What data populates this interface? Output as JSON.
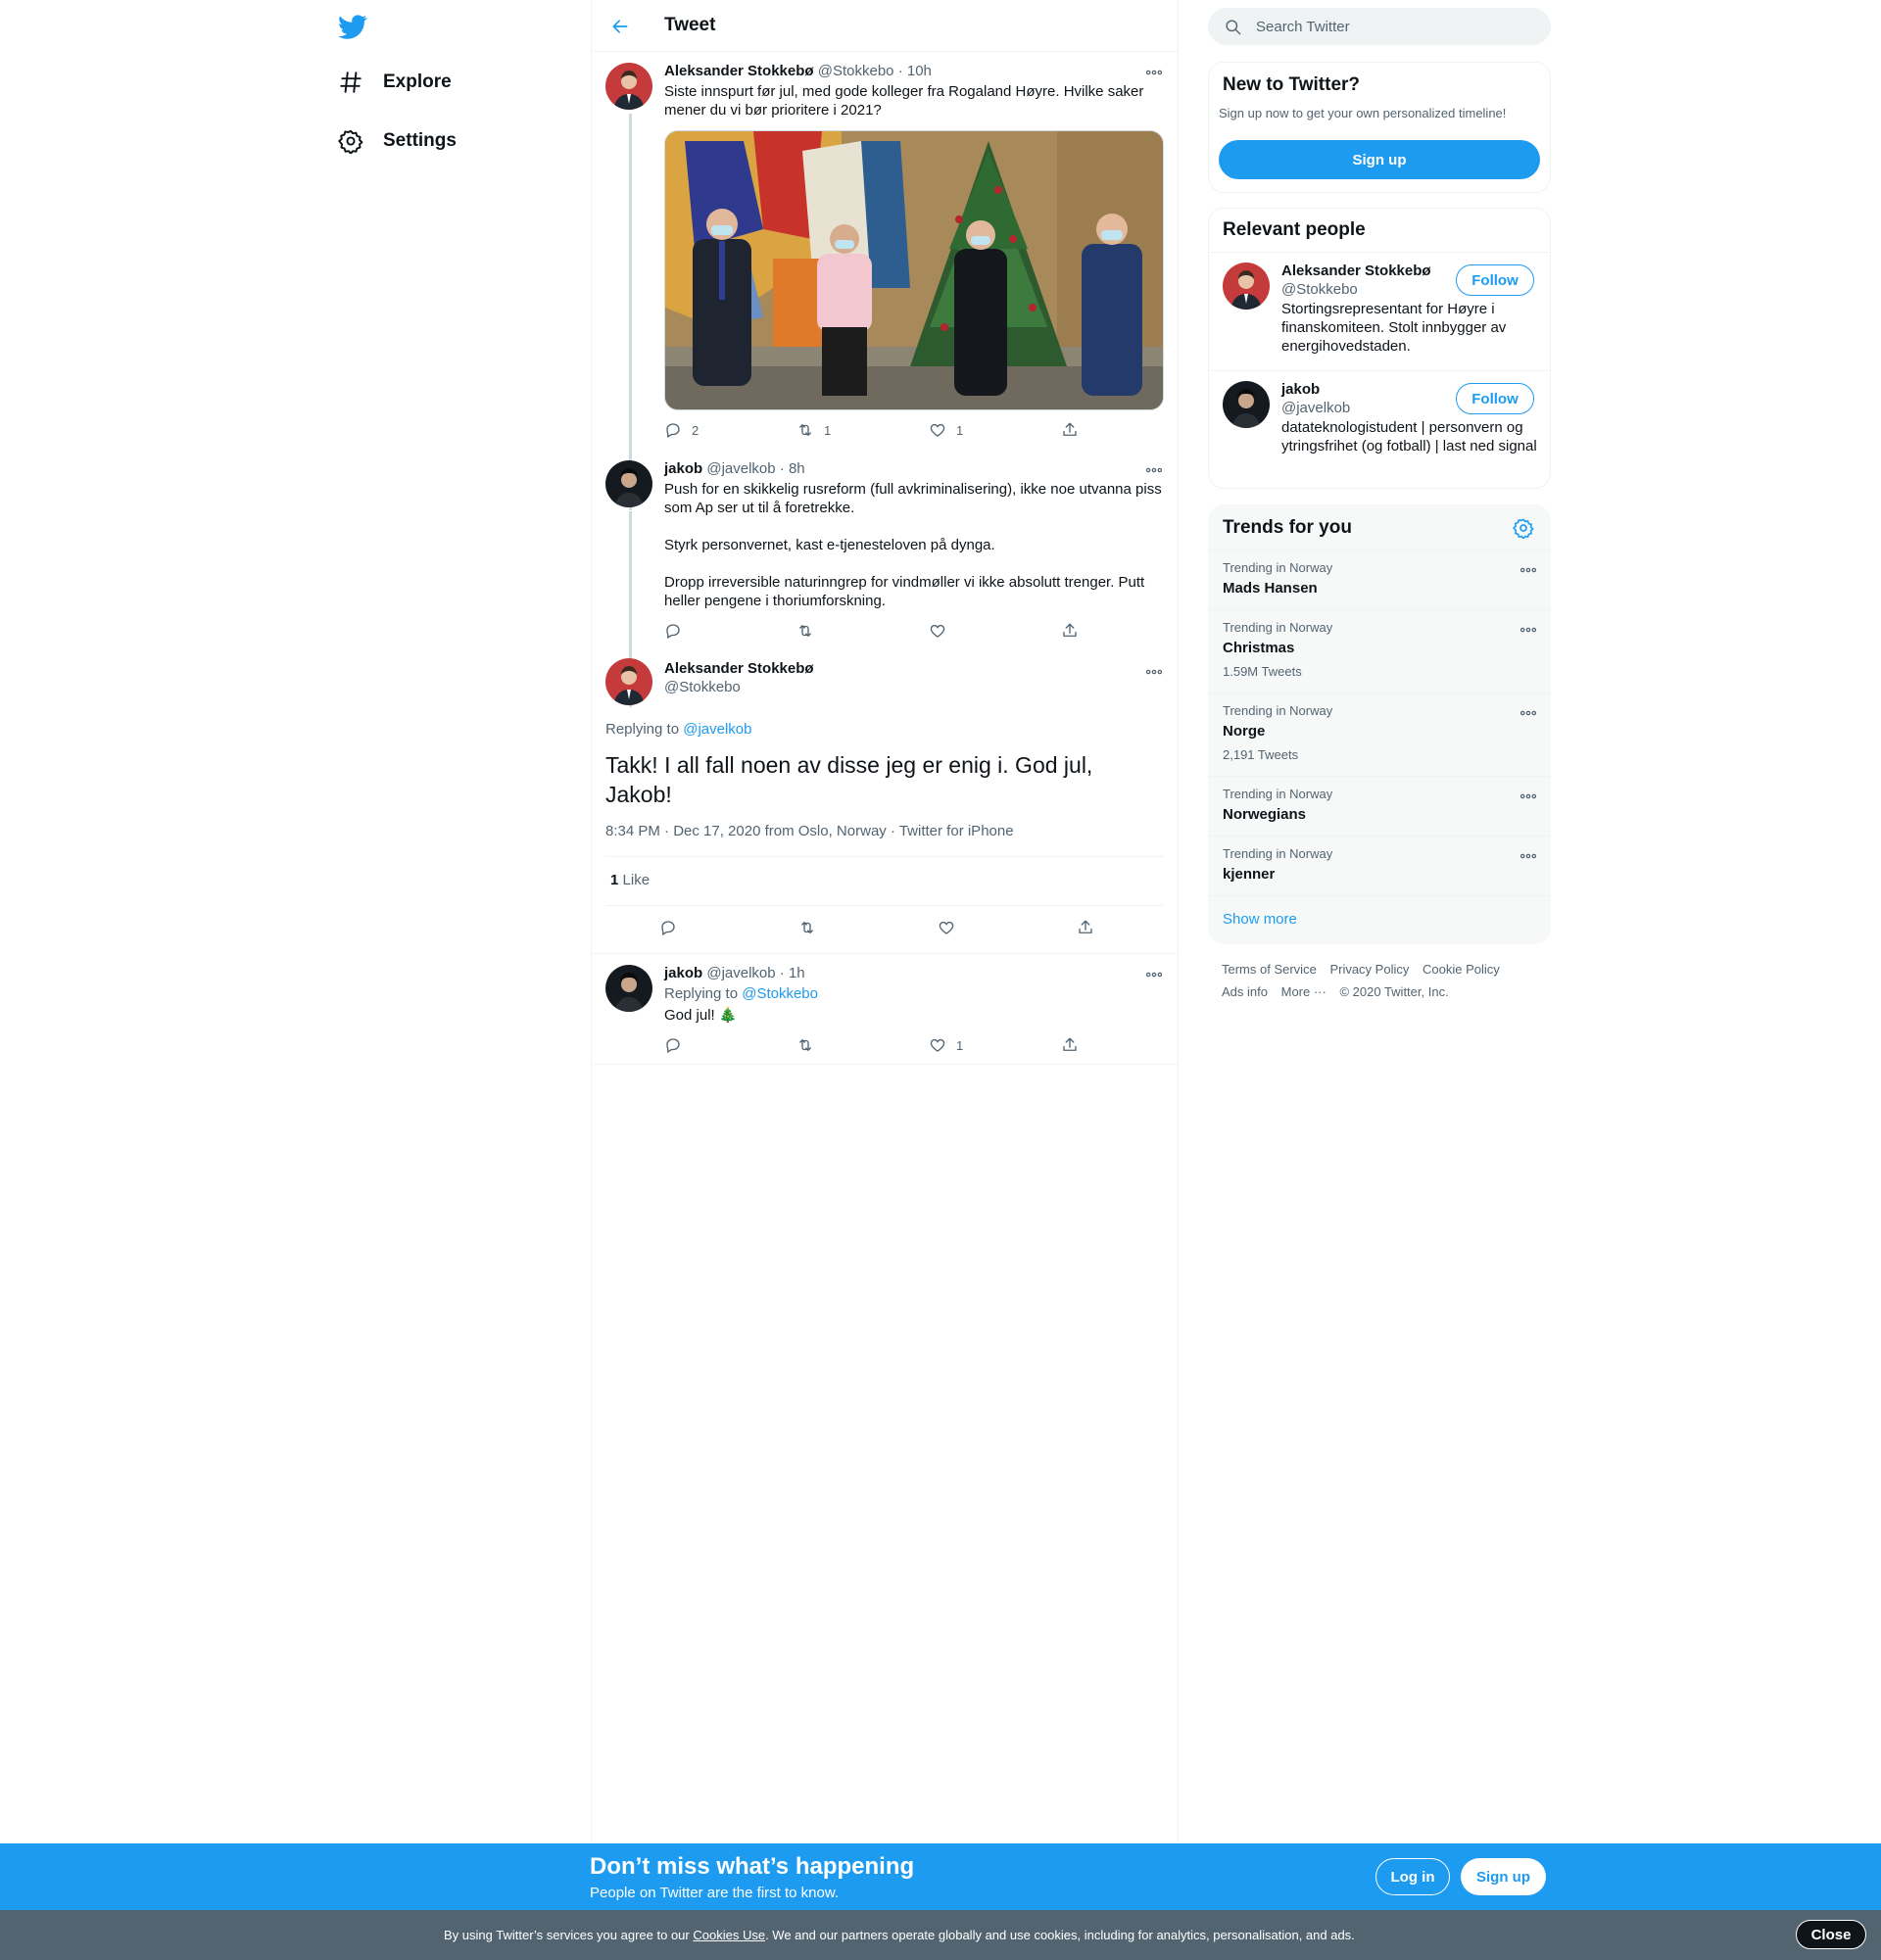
{
  "nav": {
    "logo_icon": "twitter-bird-icon",
    "items": [
      {
        "label": "Explore",
        "icon": "hashtag-icon"
      },
      {
        "label": "Settings",
        "icon": "gear-icon"
      }
    ]
  },
  "header": {
    "title": "Tweet",
    "back_icon": "arrow-left-icon"
  },
  "thread": [
    {
      "name": "Aleksander Stokkebø",
      "handle": "@Stokkebo",
      "time": "10h",
      "text": "Siste innspurt før jul, med gode kolleger fra Rogaland Høyre. Hvilke saker mener du vi bør prioritere i 2021?",
      "has_photo": true,
      "replies": "2",
      "retweets": "1",
      "likes": "1"
    },
    {
      "name": "jakob",
      "handle": "@javelkob",
      "time": "8h",
      "text_paragraphs": [
        "Push for en skikkelig rusreform (full avkriminalisering), ikke noe utvanna piss som Ap ser ut til å foretrekke.",
        "Styrk personvernet, kast e-tjenesteloven på dynga.",
        "Dropp irreversible naturinngrep for vindmøller vi ikke absolutt trenger. Putt heller pengene i thoriumforskning."
      ]
    }
  ],
  "main_tweet": {
    "name": "Aleksander Stokkebø",
    "handle": "@Stokkebo",
    "replying_to_prefix": "Replying to",
    "replying_to": "@javelkob",
    "text": "Takk! I all fall noen av disse jeg er enig i. God jul, Jakob!",
    "timestamp": "8:34 PM · Dec 17, 2020 from Oslo, Norway · Twitter for iPhone",
    "like_count": "1",
    "like_label": "Like"
  },
  "reply": {
    "name": "jakob",
    "handle": "@javelkob",
    "time": "1h",
    "replying_to_prefix": "Replying to",
    "replying_to": "@Stokkebo",
    "text": "God jul! 🎄",
    "likes": "1"
  },
  "search": {
    "placeholder": "Search Twitter"
  },
  "new_to_twitter": {
    "title": "New to Twitter?",
    "subtitle": "Sign up now to get your own personalized timeline!",
    "button": "Sign up"
  },
  "relevant_people": {
    "title": "Relevant people",
    "people": [
      {
        "name": "Aleksander Stokkebø",
        "handle": "@Stokkebo",
        "bio": "Stortingsrepresentant for Høyre i finanskomiteen. Stolt innbygger av energihovedstaden.",
        "button": "Follow"
      },
      {
        "name": "jakob",
        "handle": "@javelkob",
        "bio": "datateknologistudent | personvern og ytringsfrihet (og fotball) | last ned signal",
        "button": "Follow"
      }
    ]
  },
  "trends": {
    "title": "Trends for you",
    "items": [
      {
        "context": "Trending in Norway",
        "name": "Mads Hansen",
        "count": ""
      },
      {
        "context": "Trending in Norway",
        "name": "Christmas",
        "count": "1.59M Tweets"
      },
      {
        "context": "Trending in Norway",
        "name": "Norge",
        "count": "2,191 Tweets"
      },
      {
        "context": "Trending in Norway",
        "name": "Norwegians",
        "count": ""
      },
      {
        "context": "Trending in Norway",
        "name": "kjenner",
        "count": ""
      }
    ],
    "show_more": "Show more"
  },
  "footer": {
    "links": [
      "Terms of Service",
      "Privacy Policy",
      "Cookie Policy",
      "Ads info",
      "More ···"
    ],
    "copyright": "© 2020 Twitter, Inc."
  },
  "signup_bar": {
    "title": "Don’t miss what’s happening",
    "subtitle": "People on Twitter are the first to know.",
    "login": "Log in",
    "signup": "Sign up"
  },
  "cookie_bar": {
    "text_before": "By using Twitter’s services you agree to our",
    "link": "Cookies Use",
    "text_after": ". We and our partners operate globally and use cookies, including for analytics, personalisation, and ads.",
    "close": "Close"
  },
  "colors": {
    "accent": "#1d9bf0",
    "text": "#0f1419",
    "secondary": "#536471",
    "border": "#eff3f4"
  }
}
